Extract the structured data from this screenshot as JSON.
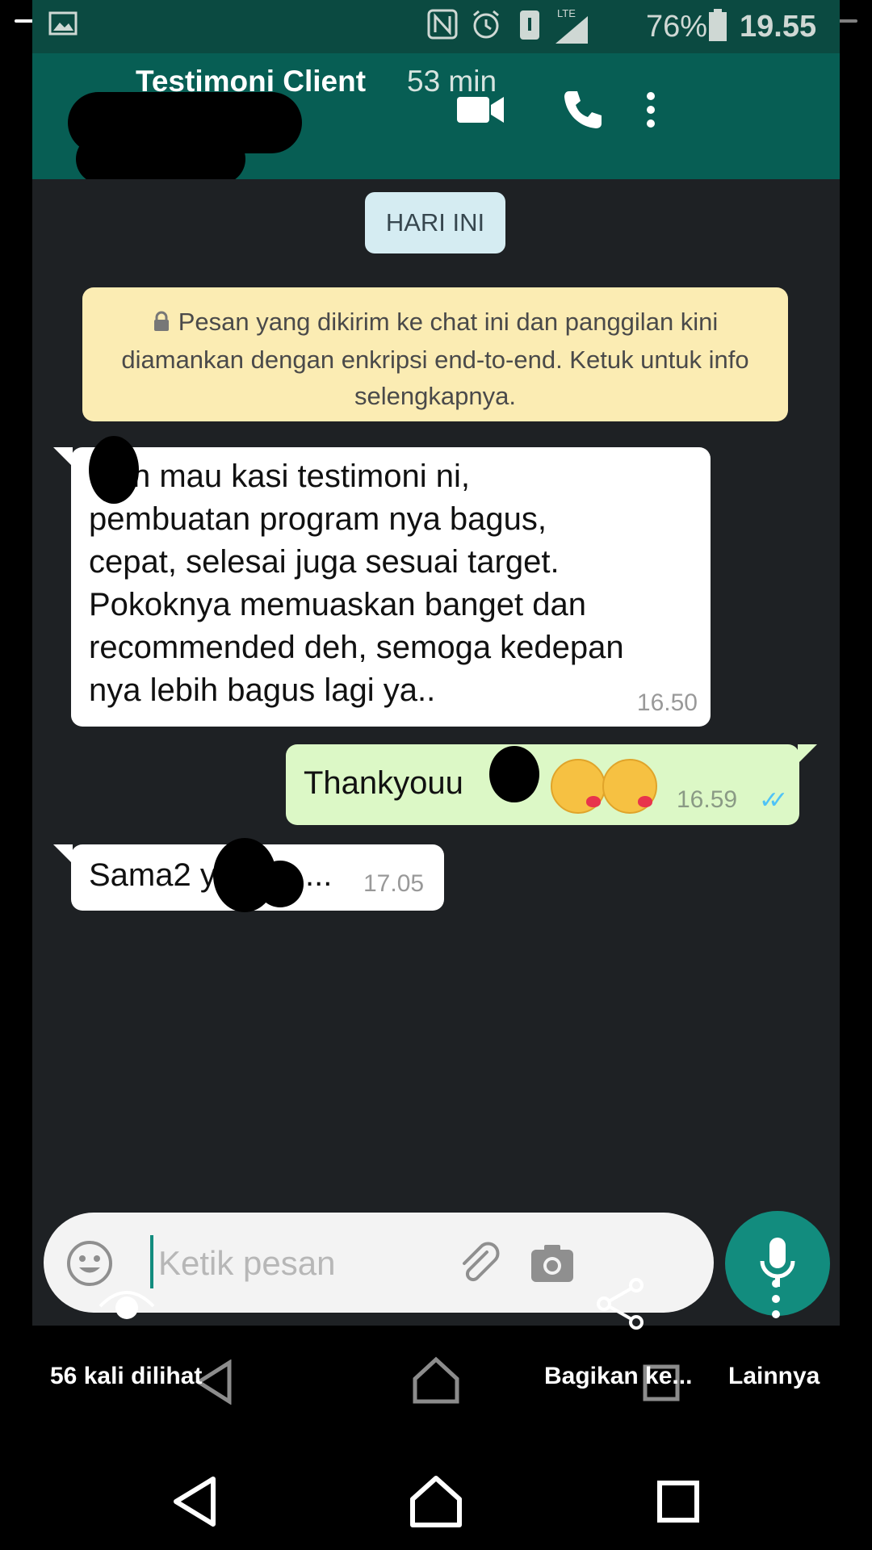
{
  "status_bar": {
    "battery": "76%",
    "network": "LTE",
    "time": "19.55"
  },
  "chat_header": {
    "title": "Testimoni Client",
    "time_ago": "53 min"
  },
  "chat": {
    "date_chip": "HARI INI",
    "encryption_notice": "Pesan yang dikirim ke chat ini dan panggilan kini diamankan dengan enkripsi end-to-end. Ketuk untuk info selengkapnya.",
    "messages": [
      {
        "direction": "incoming",
        "text_lines": [
          "h mau kasi testimoni ni,",
          "pembuatan program nya bagus,",
          "cepat, selesai juga sesuai target.",
          "Pokoknya memuaskan banget dan",
          "recommended deh, semoga kedepan",
          "nya lebih bagus lagi ya.."
        ],
        "time": "16.50"
      },
      {
        "direction": "outgoing",
        "text": "Thankyouu",
        "time": "16.59",
        "status": "read"
      },
      {
        "direction": "incoming",
        "text_before": "Sama2 y",
        "text_after": "...",
        "time": "17.05"
      }
    ]
  },
  "composer": {
    "placeholder": "Ketik pesan"
  },
  "story_footer": {
    "views": "56 kali dilihat",
    "share": "Bagikan ke...",
    "more": "Lainnya"
  },
  "colors": {
    "header_green": "#075e54",
    "outgoing_bubble": "#dcf8c6",
    "mic_button": "#128c7e",
    "chat_bg": "#1e2124",
    "encryption_banner": "#fbecb3",
    "date_chip": "#d5ecf2"
  },
  "icons": [
    "image-icon",
    "nfc-icon",
    "alarm-icon",
    "vibrate-icon",
    "signal-icon",
    "battery-icon",
    "video-call-icon",
    "phone-icon",
    "more-vert-icon",
    "lock-icon",
    "double-check-icon",
    "emoji-icon",
    "attach-icon",
    "camera-icon",
    "mic-icon",
    "eye-icon",
    "share-icon",
    "more-dots-icon",
    "back-icon",
    "home-icon",
    "recent-apps-icon"
  ]
}
